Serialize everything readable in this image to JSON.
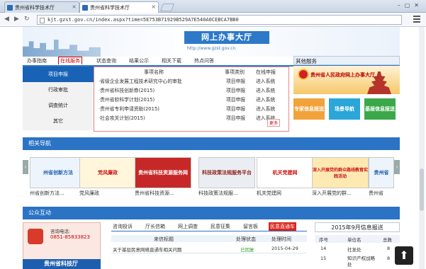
{
  "browser": {
    "tabs": [
      {
        "label": "贵州省科学技术厅"
      },
      {
        "label": "贵州省科学技术厅"
      }
    ],
    "url": "kjt.gzst.gov.cn/index.aspx?time=5E753B71929B529A7E540A0CEBCA7BB0"
  },
  "banner": {
    "title": "网上办事大厅",
    "subtitle": "http://www.gzst.gov.cn"
  },
  "nav": {
    "items": [
      "办事指南",
      "在线服务",
      "状态查询",
      "结果公示",
      "相关下载",
      "热点问答"
    ],
    "other_services": "其他服务"
  },
  "side_menu": [
    "项目申报",
    "行政审批",
    "调查统计",
    "其它"
  ],
  "projects": {
    "headers": [
      "事项名称",
      "事项类别",
      "在线申报"
    ],
    "rows": [
      {
        "name": "·省级企业发展工程技术研究中心的审批",
        "type": "项目申报",
        "action": "进入系统"
      },
      {
        "name": "·贵州省科技创新券(2015)",
        "type": "项目申报",
        "action": "进入系统"
      },
      {
        "name": "·贵州省软科学计划(2015)",
        "type": "项目申报",
        "action": "进入系统"
      },
      {
        "name": "·贵州省专利申请资助(2015)",
        "type": "项目申报",
        "action": "进入系统"
      },
      {
        "name": "·社会攻关计划(2015)",
        "type": "项目申报",
        "action": "进入系统"
      }
    ],
    "more": "更多"
  },
  "right_panel": {
    "banner_text": "贵州省人民政府网上办事大厅",
    "tiles": [
      {
        "label": "专家信息报送",
        "color": "#f2a23a"
      },
      {
        "label": "场景导航",
        "color": "#2aa6d8"
      },
      {
        "label": "基层信息报送",
        "color": "#3aa84a"
      }
    ]
  },
  "related": {
    "section_title": "相关导航",
    "links": [
      {
        "image_text": "州省创新方法",
        "caption": "州省创新方法..."
      },
      {
        "image_text": "党风廉政",
        "caption": "党风廉政"
      },
      {
        "image_text": "贵州省科技资源服务网",
        "caption": "贵州省科技资源..."
      },
      {
        "image_text": "科技政策法规服务平台",
        "caption": "科技政策法规服..."
      },
      {
        "image_text": "机关党建网",
        "caption": "机关党建网"
      },
      {
        "image_text": "深入开展党的群众路线教育实践活动",
        "caption": "深入开展党的群..."
      },
      {
        "image_text": "贵州省",
        "caption": "贵州省"
      }
    ]
  },
  "interaction": {
    "section_title": "公众互动",
    "phone_label": "咨询电话:",
    "phone_number": "0851-85833823",
    "kj_label": "贵州省科技厅",
    "tabs": [
      "咨询投诉",
      "厅长信箱",
      "网上调查",
      "民意征集",
      "留言板",
      "民意直通车"
    ],
    "headers": [
      "来信标题",
      "处理状态",
      "处理时间"
    ],
    "rows": [
      {
        "title": "关于基层民意网络直通车相关问题",
        "status": "已回复",
        "time": "2015-04-29"
      }
    ],
    "report_title": "2015年9月信息报送",
    "report_headers": [
      "序号",
      "单位名",
      "总数"
    ],
    "report_rows": [
      {
        "no": "14",
        "unit": "社发处",
        "count": "8"
      },
      {
        "no": "15",
        "unit": "知识产权战略处",
        "count": "8"
      }
    ]
  }
}
